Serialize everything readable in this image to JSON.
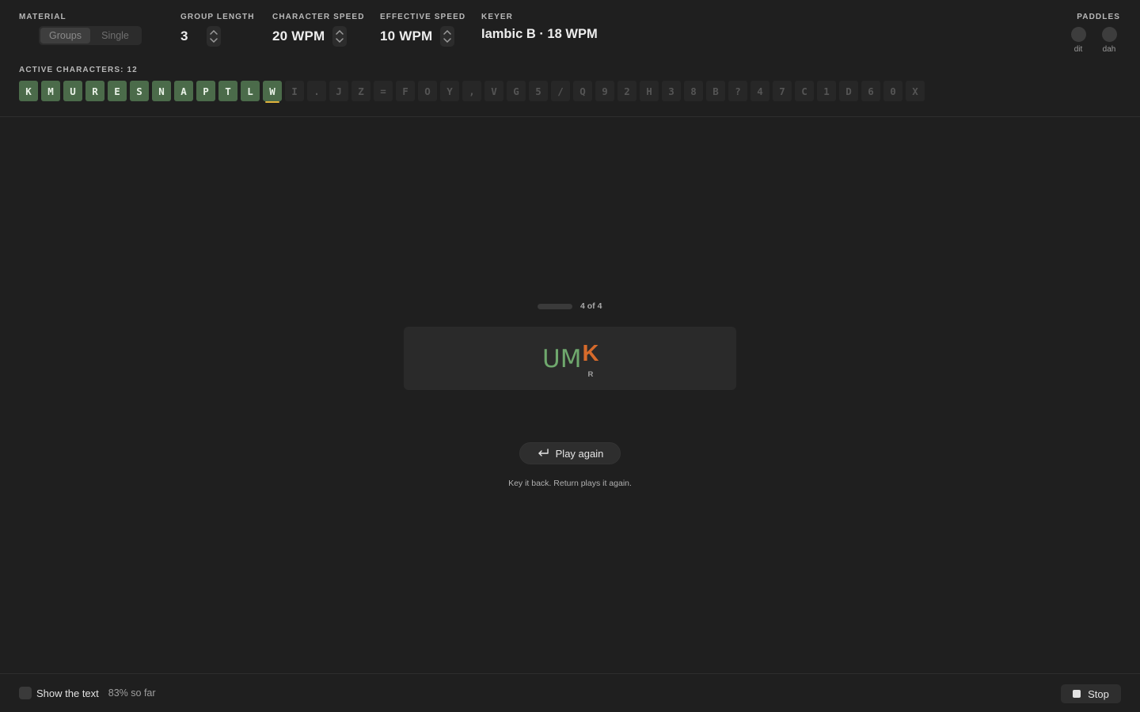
{
  "material": {
    "label": "MATERIAL",
    "options": [
      "Groups",
      "Single"
    ],
    "selected": "Groups"
  },
  "group_length": {
    "label": "GROUP LENGTH",
    "value": "3"
  },
  "character_speed": {
    "label": "CHARACTER SPEED",
    "value": "20 WPM"
  },
  "effective_speed": {
    "label": "EFFECTIVE SPEED",
    "value": "10 WPM"
  },
  "keyer": {
    "label": "KEYER",
    "value": "Iambic B · 18 WPM"
  },
  "paddles": {
    "label": "PADDLES",
    "dit": "dit",
    "dah": "dah"
  },
  "active_characters": {
    "label": "ACTIVE CHARACTERS: 12",
    "current": "W",
    "chars": [
      {
        "c": "K",
        "active": true
      },
      {
        "c": "M",
        "active": true
      },
      {
        "c": "U",
        "active": true
      },
      {
        "c": "R",
        "active": true
      },
      {
        "c": "E",
        "active": true
      },
      {
        "c": "S",
        "active": true
      },
      {
        "c": "N",
        "active": true
      },
      {
        "c": "A",
        "active": true
      },
      {
        "c": "P",
        "active": true
      },
      {
        "c": "T",
        "active": true
      },
      {
        "c": "L",
        "active": true
      },
      {
        "c": "W",
        "active": true
      },
      {
        "c": "I",
        "active": false
      },
      {
        "c": ".",
        "active": false
      },
      {
        "c": "J",
        "active": false
      },
      {
        "c": "Z",
        "active": false
      },
      {
        "c": "=",
        "active": false
      },
      {
        "c": "F",
        "active": false
      },
      {
        "c": "O",
        "active": false
      },
      {
        "c": "Y",
        "active": false
      },
      {
        "c": ",",
        "active": false
      },
      {
        "c": "V",
        "active": false
      },
      {
        "c": "G",
        "active": false
      },
      {
        "c": "5",
        "active": false
      },
      {
        "c": "/",
        "active": false
      },
      {
        "c": "Q",
        "active": false
      },
      {
        "c": "9",
        "active": false
      },
      {
        "c": "2",
        "active": false
      },
      {
        "c": "H",
        "active": false
      },
      {
        "c": "3",
        "active": false
      },
      {
        "c": "8",
        "active": false
      },
      {
        "c": "B",
        "active": false
      },
      {
        "c": "?",
        "active": false
      },
      {
        "c": "4",
        "active": false
      },
      {
        "c": "7",
        "active": false
      },
      {
        "c": "C",
        "active": false
      },
      {
        "c": "1",
        "active": false
      },
      {
        "c": "D",
        "active": false
      },
      {
        "c": "6",
        "active": false
      },
      {
        "c": "0",
        "active": false
      },
      {
        "c": "X",
        "active": false
      }
    ]
  },
  "progress": {
    "text": "4 of 4",
    "fraction": 1.0
  },
  "answer": {
    "correct_chars": [
      "U",
      "M"
    ],
    "wrong_typed": "K",
    "wrong_expected": "R"
  },
  "play_again": {
    "label": "Play again"
  },
  "hint": "Key it back. Return plays it again.",
  "footer": {
    "show_text_label": "Show the text",
    "so_far": "83% so far",
    "stop_label": "Stop"
  },
  "colors": {
    "active_chip": "#4b6b4a",
    "correct": "#6fa86d",
    "wrong": "#d66a2b",
    "current_marker": "#e1b33c"
  }
}
